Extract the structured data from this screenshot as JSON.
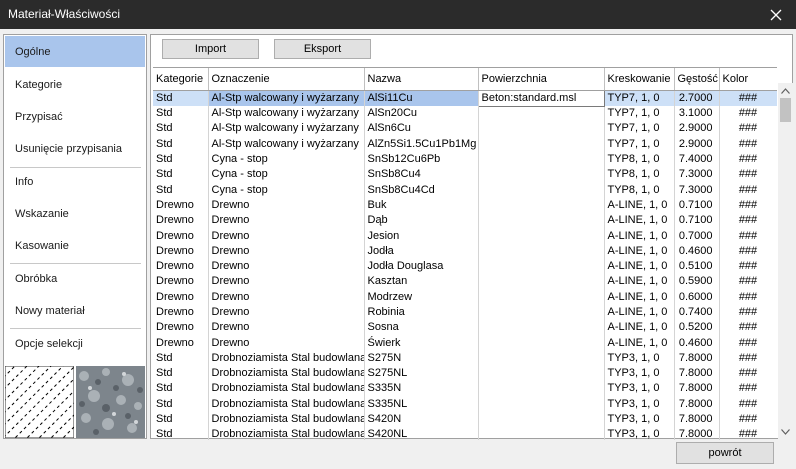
{
  "window": {
    "title": "Materiał-Właściwości"
  },
  "toolbar": {
    "import_label": "Import",
    "export_label": "Eksport"
  },
  "sidebar": {
    "items": [
      {
        "label": "Ogólne",
        "selected": true
      },
      {
        "label": "Kategorie"
      },
      {
        "label": "Przypisać"
      },
      {
        "label": "Usunięcie przypisania"
      },
      {
        "label": "Info"
      },
      {
        "label": "Wskazanie"
      },
      {
        "label": "Kasowanie"
      },
      {
        "label": "Obróbka"
      },
      {
        "label": "Nowy materiał"
      },
      {
        "label": "Opcje selekcji"
      }
    ]
  },
  "table": {
    "columns": [
      "Kategorie",
      "Oznaczenie",
      "Nazwa",
      "Powierzchnia",
      "Kreskowanie",
      "Gęstość",
      "Kolor"
    ],
    "rows": [
      [
        "Std",
        "Al-Stp walcowany i wyżarzany",
        "AlSi11Cu",
        "Beton:standard.msl",
        "TYP7, 1, 0",
        "2.7000",
        "###"
      ],
      [
        "Std",
        "Al-Stp walcowany i wyżarzany",
        "AlSn20Cu",
        "",
        "TYP7, 1, 0",
        "3.1000",
        "###"
      ],
      [
        "Std",
        "Al-Stp walcowany i wyżarzany",
        "AlSn6Cu",
        "",
        "TYP7, 1, 0",
        "2.9000",
        "###"
      ],
      [
        "Std",
        "Al-Stp walcowany i wyżarzany",
        "AlZn5Si1.5Cu1Pb1Mg",
        "",
        "TYP7, 1, 0",
        "2.9000",
        "###"
      ],
      [
        "Std",
        "Cyna - stop",
        "SnSb12Cu6Pb",
        "",
        "TYP8, 1, 0",
        "7.4000",
        "###"
      ],
      [
        "Std",
        "Cyna - stop",
        "SnSb8Cu4",
        "",
        "TYP8, 1, 0",
        "7.3000",
        "###"
      ],
      [
        "Std",
        "Cyna - stop",
        "SnSb8Cu4Cd",
        "",
        "TYP8, 1, 0",
        "7.3000",
        "###"
      ],
      [
        "Drewno",
        "Drewno",
        "Buk",
        "",
        "A-LINE, 1, 0",
        "0.7100",
        "###"
      ],
      [
        "Drewno",
        "Drewno",
        "Dąb",
        "",
        "A-LINE, 1, 0",
        "0.7100",
        "###"
      ],
      [
        "Drewno",
        "Drewno",
        "Jesion",
        "",
        "A-LINE, 1, 0",
        "0.7000",
        "###"
      ],
      [
        "Drewno",
        "Drewno",
        "Jodła",
        "",
        "A-LINE, 1, 0",
        "0.4600",
        "###"
      ],
      [
        "Drewno",
        "Drewno",
        "Jodła Douglasa",
        "",
        "A-LINE, 1, 0",
        "0.5100",
        "###"
      ],
      [
        "Drewno",
        "Drewno",
        "Kasztan",
        "",
        "A-LINE, 1, 0",
        "0.5900",
        "###"
      ],
      [
        "Drewno",
        "Drewno",
        "Modrzew",
        "",
        "A-LINE, 1, 0",
        "0.6000",
        "###"
      ],
      [
        "Drewno",
        "Drewno",
        "Robinia",
        "",
        "A-LINE, 1, 0",
        "0.7400",
        "###"
      ],
      [
        "Drewno",
        "Drewno",
        "Sosna",
        "",
        "A-LINE, 1, 0",
        "0.5200",
        "###"
      ],
      [
        "Drewno",
        "Drewno",
        "Świerk",
        "",
        "A-LINE, 1, 0",
        "0.4600",
        "###"
      ],
      [
        "Std",
        "Drobnoziamista Stal budowlana",
        "S275N",
        "",
        "TYP3, 1, 0",
        "7.8000",
        "###"
      ],
      [
        "Std",
        "Drobnoziamista Stal budowlana",
        "S275NL",
        "",
        "TYP3, 1, 0",
        "7.8000",
        "###"
      ],
      [
        "Std",
        "Drobnoziamista Stal budowlana",
        "S335N",
        "",
        "TYP3, 1, 0",
        "7.8000",
        "###"
      ],
      [
        "Std",
        "Drobnoziamista Stal budowlana",
        "S335NL",
        "",
        "TYP3, 1, 0",
        "7.8000",
        "###"
      ],
      [
        "Std",
        "Drobnoziamista Stal budowlana",
        "S420N",
        "",
        "TYP3, 1, 0",
        "7.8000",
        "###"
      ],
      [
        "Std",
        "Drobnoziamista Stal budowlana",
        "S420NL",
        "",
        "TYP3, 1, 0",
        "7.8000",
        "###"
      ]
    ],
    "selected_row": 0
  },
  "footer": {
    "back_label": "powrót"
  },
  "colors": {
    "titlebar": "#2b2b2b",
    "selection": "#a9c5ec",
    "row_selection": "#cde0f7"
  }
}
